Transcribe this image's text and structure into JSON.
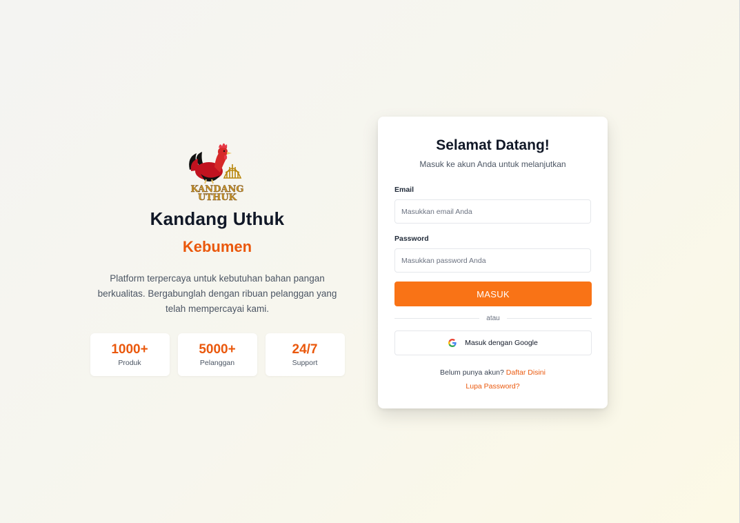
{
  "brand": {
    "logo_text_line1": "KANDANG",
    "logo_text_line2": "UTHUK",
    "title": "Kandang Uthuk",
    "subtitle": "Kebumen",
    "description": "Platform terpercaya untuk kebutuhan bahan pangan berkualitas. Bergabunglah dengan ribuan pelanggan yang telah mempercayai kami."
  },
  "stats": [
    {
      "value": "1000+",
      "label": "Produk"
    },
    {
      "value": "5000+",
      "label": "Pelanggan"
    },
    {
      "value": "24/7",
      "label": "Support"
    }
  ],
  "login": {
    "title": "Selamat Datang!",
    "subtitle": "Masuk ke akun Anda untuk melanjutkan",
    "email_label": "Email",
    "email_placeholder": "Masukkan email Anda",
    "email_value": "",
    "password_label": "Password",
    "password_placeholder": "Masukkan password Anda",
    "password_value": "",
    "submit_label": "MASUK",
    "divider_text": "atau",
    "google_label": "Masuk dengan Google",
    "register_prompt": "Belum punya akun?",
    "register_link": "Daftar Disini",
    "forgot_link": "Lupa Password?"
  },
  "colors": {
    "accent": "#f97316",
    "accent_text": "#ea580c",
    "heading": "#111827"
  }
}
